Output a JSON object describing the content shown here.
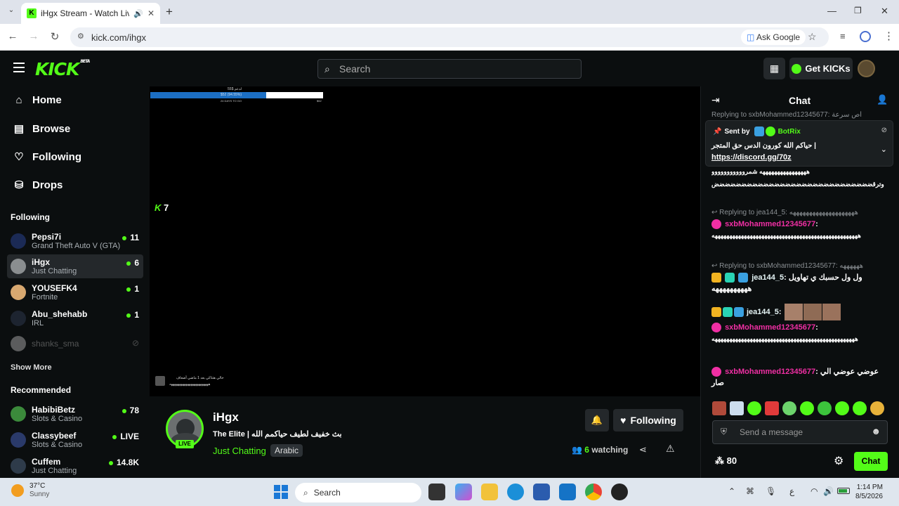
{
  "browser": {
    "tab_title": "iHgx Stream - Watch Live o",
    "url": "kick.com/ihgx",
    "ask_google": "Ask Google",
    "new_tab": "+"
  },
  "header": {
    "logo": "KICK",
    "logo_beta": "BETA",
    "search_placeholder": "Search",
    "get_kicks": "Get KICKs"
  },
  "sidebar": {
    "nav": [
      {
        "label": "Home",
        "icon": "home-icon"
      },
      {
        "label": "Browse",
        "icon": "browse-icon"
      },
      {
        "label": "Following",
        "icon": "heart-icon"
      },
      {
        "label": "Drops",
        "icon": "drops-icon"
      }
    ],
    "following_title": "Following",
    "following": [
      {
        "name": "Pepsi7i",
        "category": "Grand Theft Auto V (GTA)",
        "viewers": "11"
      },
      {
        "name": "iHgx",
        "category": "Just Chatting",
        "viewers": "6"
      },
      {
        "name": "YOUSEFK4",
        "category": "Fortnite",
        "viewers": "1"
      },
      {
        "name": "Abu_shehabb",
        "category": "IRL",
        "viewers": "1"
      },
      {
        "name": "shanks_sma",
        "category": "",
        "viewers": ""
      }
    ],
    "show_more": "Show More",
    "recommended_title": "Recommended",
    "recommended": [
      {
        "name": "HabibiBetz",
        "category": "Slots & Casino",
        "viewers": "78"
      },
      {
        "name": "Classybeef",
        "category": "Slots & Casino",
        "viewers": "LIVE"
      },
      {
        "name": "Cuffem",
        "category": "Just Chatting",
        "viewers": "14.8K"
      }
    ]
  },
  "player": {
    "overlay_kick_count": "7",
    "overlay_bar_top": "لدعم $55",
    "overlay_bar_mid": "$52 (94.55%)",
    "overlay_bar_left": "24 DAYS TO GO",
    "overlay_bar_right": "$52",
    "overlay_chat_line1": "حالي هتتاكي بعد 1 ماضي أضعاف",
    "overlay_chat_line2": "ههههههههههههههههههههههههه"
  },
  "stream": {
    "channel": "iHgx",
    "live": "LIVE",
    "title": "The Elite | بث خفيف لطيف حياكمم الله",
    "category": "Just Chatting",
    "tag": "Arabic",
    "following_btn": "Following",
    "viewers": "6",
    "viewers_label": "watching"
  },
  "chat": {
    "title": "Chat",
    "pinned": {
      "sent_by": "Sent by",
      "bot": "BotRix",
      "text": "حياكم الله كورون الدس حق المتجر |",
      "link": "https://discord.gg/70z"
    },
    "partial_reply": "Replying to sxbMohammed12345677: اص سرعة",
    "messages": [
      {
        "reply": "",
        "user": "",
        "text": "ههههههههههههههههه شمرووووووووووو"
      },
      {
        "reply": "",
        "user": "",
        "text": "وترقضضضضضضضضضضضضضضضضضضضضضضضضضضضضض"
      },
      {
        "reply": "Replying to jea144_5: ههههههههههههههههههههه",
        "user": "sxbMohammed12345677",
        "text": "ههههههههههههههههههههههههههههههههههههههههههههههههههه"
      },
      {
        "reply": "Replying to sxbMohammed12345677: ههههههه",
        "user": "jea144_5",
        "text": "ول ول حسبك ي تهاويل ههههههههههه"
      },
      {
        "reply": "",
        "user": "jea144_5",
        "text": ""
      },
      {
        "reply": "",
        "user": "sxbMohammed12345677",
        "text": "هههههههههههههههههههههههههههههههههههههههههههههههههه"
      },
      {
        "reply": "",
        "user": "sxbMohammed12345677",
        "text": "عوضي عوضي الي صار"
      }
    ],
    "input_placeholder": "Send a message",
    "points": "80",
    "send_btn": "Chat"
  },
  "taskbar": {
    "weather_temp": "37°C",
    "weather_desc": "Sunny",
    "search": "Search",
    "time": "1:14 PM",
    "date": "8/5/2026",
    "lang": "ع"
  },
  "colors": {
    "brand_green": "#53fc18",
    "chat_pink": "#f02fa4",
    "background": "#0b0e0f"
  }
}
